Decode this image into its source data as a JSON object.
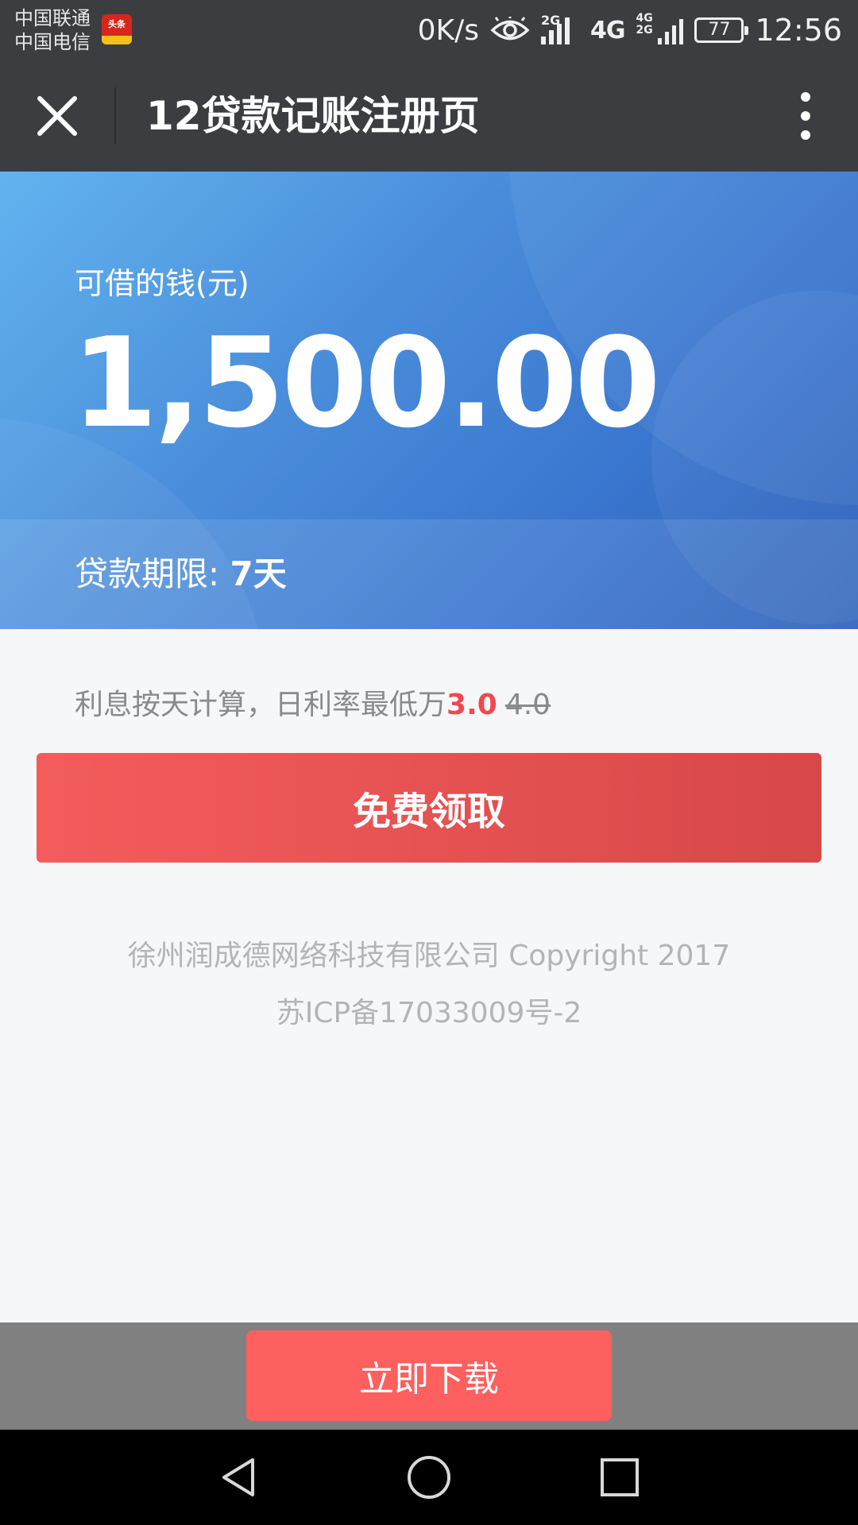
{
  "status_bar": {
    "carrier_1": "中国联通",
    "carrier_2": "中国电信",
    "app_badge_text": "头条",
    "net_speed": "0K/s",
    "signal_1_label": "2G",
    "net_4g": "4G",
    "signal_2_label": "4G 2G",
    "battery": "77",
    "time": "12:56"
  },
  "title_bar": {
    "title": "12贷款记账注册页",
    "close_icon": "close-icon",
    "more_icon": "more-vertical-icon"
  },
  "hero": {
    "amount_label": "可借的钱(元)",
    "amount_value": "1,500.00",
    "term_label": "贷款期限: ",
    "term_value": "7天"
  },
  "rate": {
    "text": "利息按天计算，日利率最低万",
    "new_value": "3.0",
    "old_value": "4.0"
  },
  "claim_button": {
    "label": "免费领取"
  },
  "footer": {
    "company": "徐州润成德网络科技有限公司 Copyright 2017",
    "icp": "苏ICP备17033009号-2"
  },
  "download_button": {
    "label": "立即下载"
  },
  "colors": {
    "header_bg": "#3c3d41",
    "accent_red": "#f0494f",
    "download_red": "#fe5f5f",
    "hero_blue": "#4a8edb"
  }
}
